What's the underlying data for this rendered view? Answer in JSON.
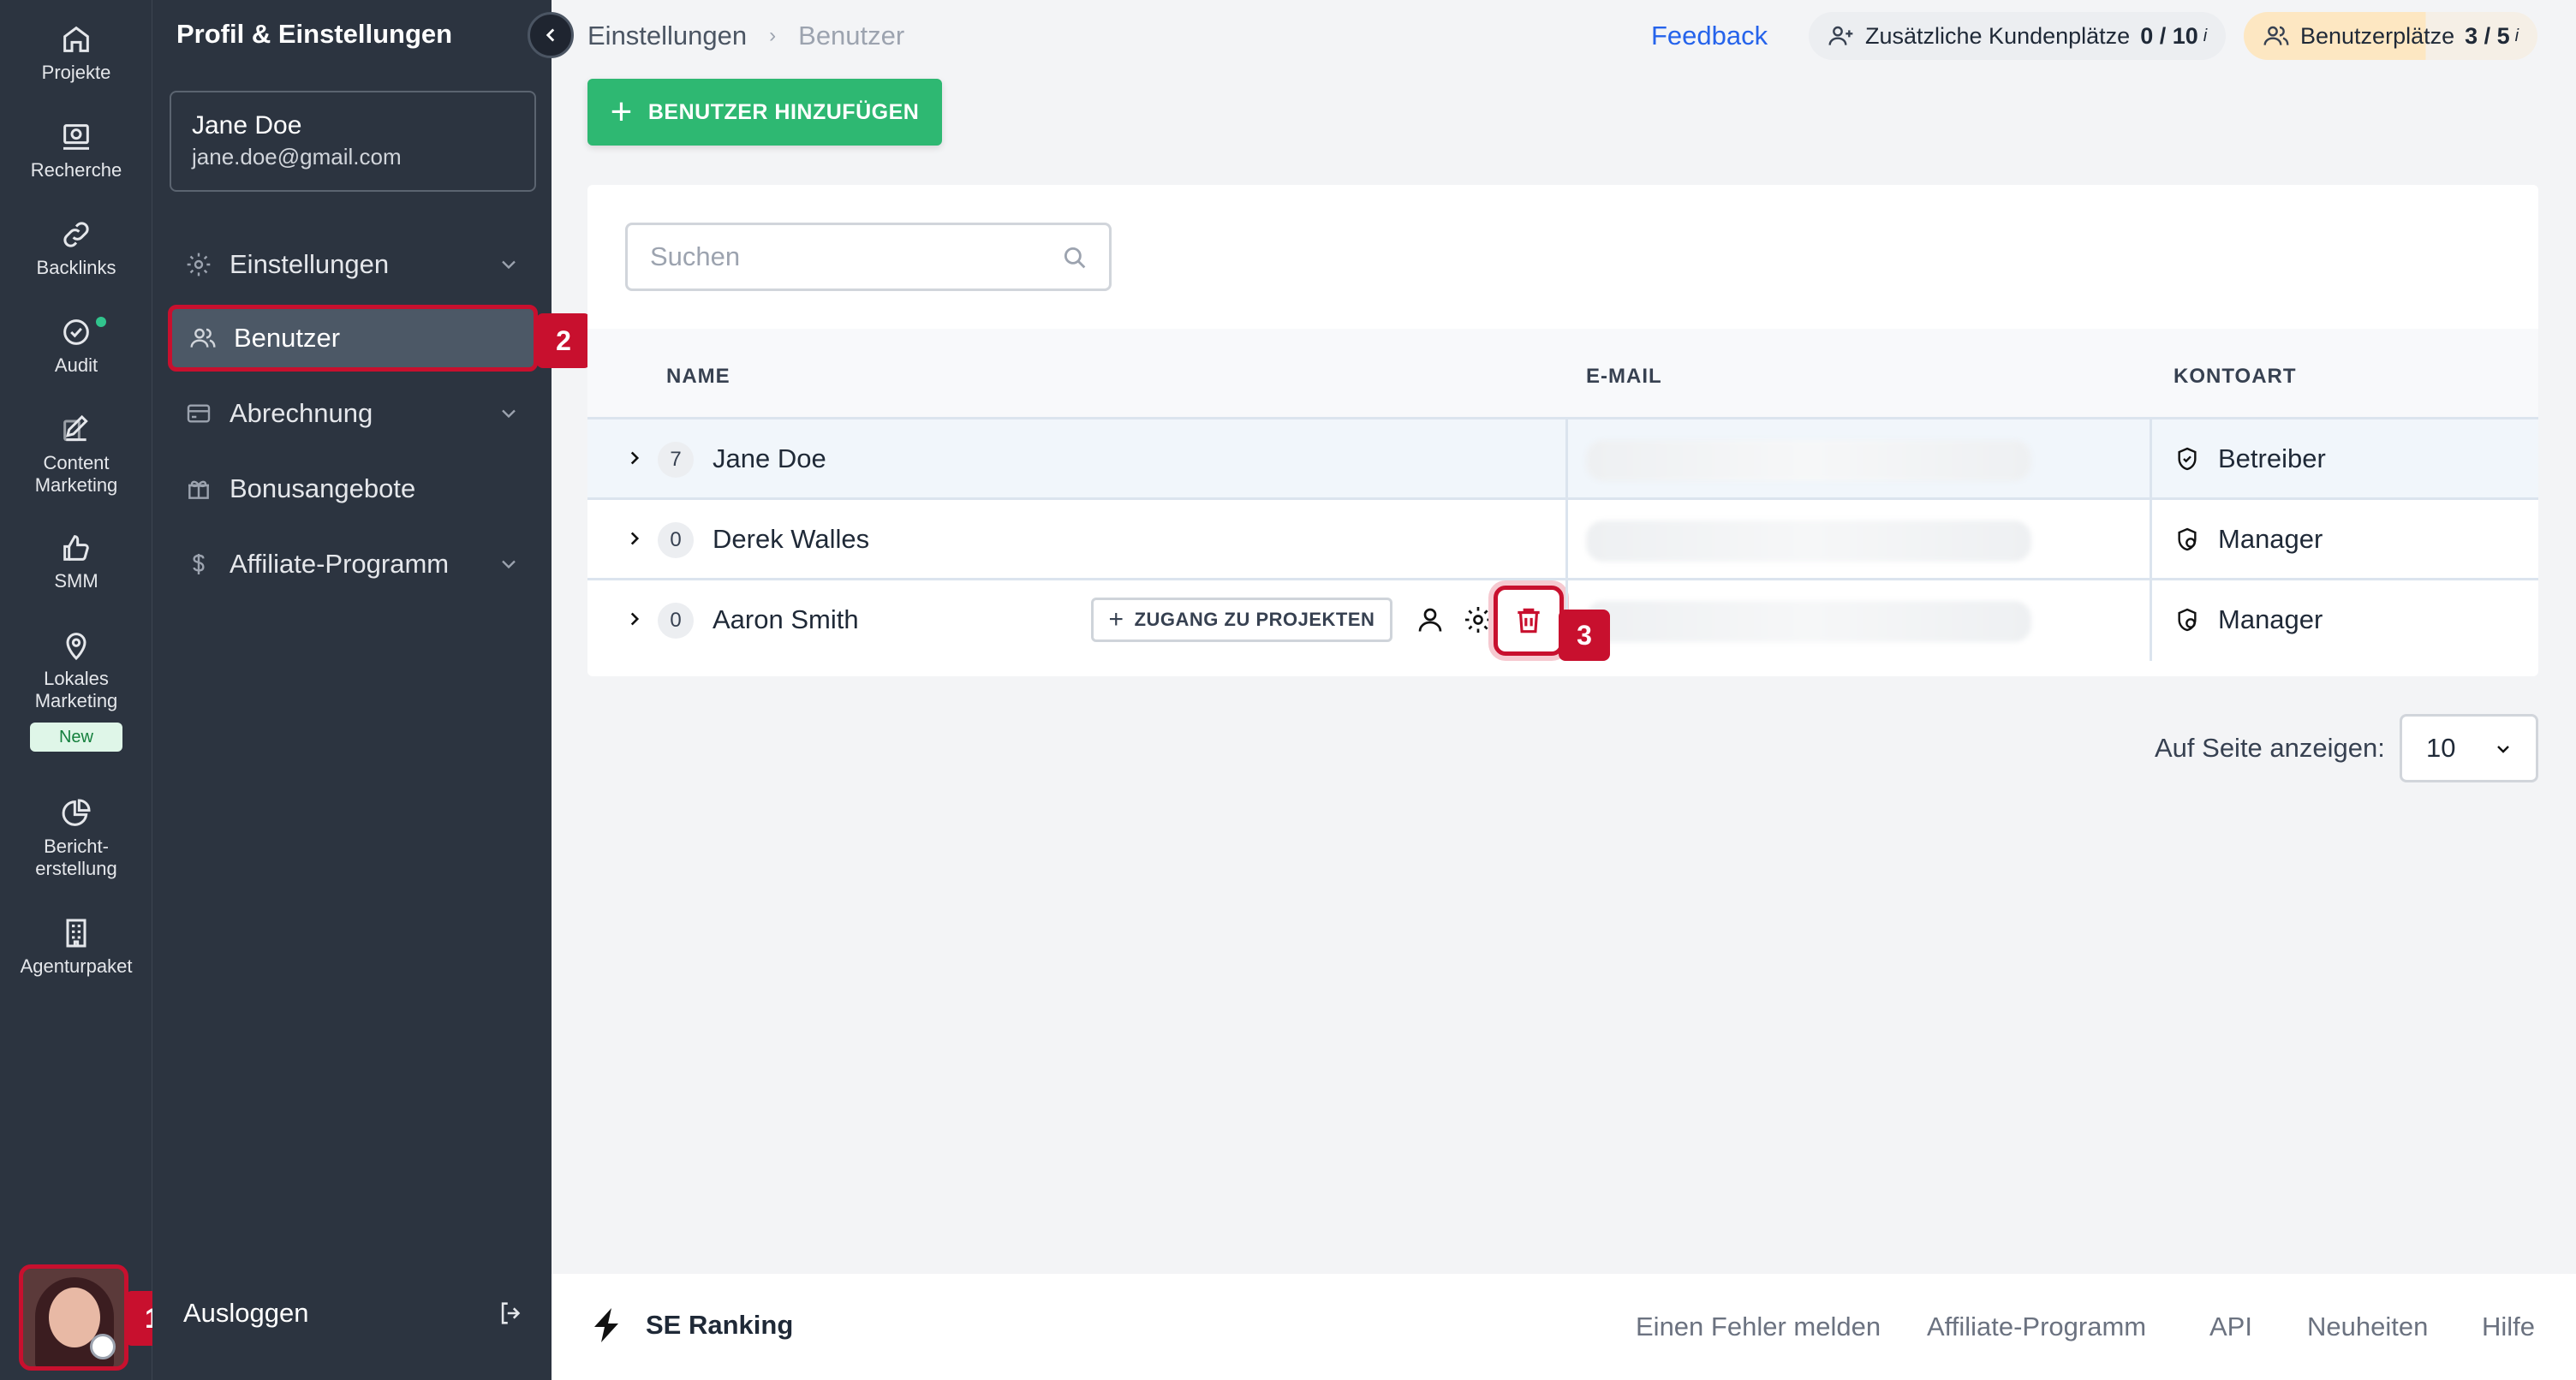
{
  "rail": {
    "items": [
      {
        "label": "Projekte",
        "icon": "home-icon"
      },
      {
        "label": "Recherche",
        "icon": "research-icon"
      },
      {
        "label": "Backlinks",
        "icon": "link-icon"
      },
      {
        "label": "Audit",
        "icon": "check-circle-icon"
      },
      {
        "label": "Content Marketing",
        "icon": "edit-icon"
      },
      {
        "label": "SMM",
        "icon": "thumbs-up-icon"
      },
      {
        "label": "Lokales Marketing",
        "icon": "map-pin-icon"
      },
      {
        "label": "Bericht-erstellung",
        "icon": "pie-chart-icon"
      },
      {
        "label": "Agenturpaket",
        "icon": "building-icon"
      }
    ],
    "new_badge": "New"
  },
  "steps": {
    "one": "1",
    "two": "2",
    "three": "3"
  },
  "sidebar": {
    "title": "Profil & Einstellungen",
    "user_name": "Jane Doe",
    "user_email": "jane.doe@gmail.com",
    "items": [
      {
        "label": "Einstellungen",
        "icon": "gear-icon"
      },
      {
        "label": "Benutzer",
        "icon": "users-icon"
      },
      {
        "label": "Abrechnung",
        "icon": "credit-card-icon"
      },
      {
        "label": "Bonusangebote",
        "icon": "gift-icon"
      },
      {
        "label": "Affiliate-Programm",
        "icon": "dollar-icon"
      }
    ],
    "logout": "Ausloggen"
  },
  "header": {
    "breadcrumb_root": "Einstellungen",
    "breadcrumb_current": "Benutzer",
    "feedback": "Feedback",
    "client_seats_label": "Zusätzliche Kundenplätze",
    "client_seats_value": "0 / 10",
    "user_seats_label": "Benutzerplätze",
    "user_seats_value": "3 / 5",
    "info_mark": "i"
  },
  "toolbar": {
    "add_user": "BENUTZER HINZUFÜGEN"
  },
  "search": {
    "placeholder": "Suchen"
  },
  "table": {
    "columns": {
      "name": "NAME",
      "email": "E-MAIL",
      "role": "KONTOART"
    },
    "rows": [
      {
        "count": "7",
        "name": "Jane Doe",
        "role": "Betreiber"
      },
      {
        "count": "0",
        "name": "Derek Walles",
        "role": "Manager"
      },
      {
        "count": "0",
        "name": "Aaron Smith",
        "role": "Manager"
      }
    ],
    "access_button": "ZUGANG ZU PROJEKTEN"
  },
  "pagination": {
    "per_page_label": "Auf Seite anzeigen:",
    "per_page_value": "10"
  },
  "footer": {
    "brand": "SE Ranking",
    "links": [
      "Einen Fehler melden",
      "Affiliate-Programm",
      "API",
      "Neuheiten",
      "Hilfe"
    ]
  },
  "colors": {
    "accent_green": "#2eb872",
    "highlight_red": "#c8102e",
    "link_blue": "#2563eb",
    "sidebar_bg": "#2c3440"
  }
}
